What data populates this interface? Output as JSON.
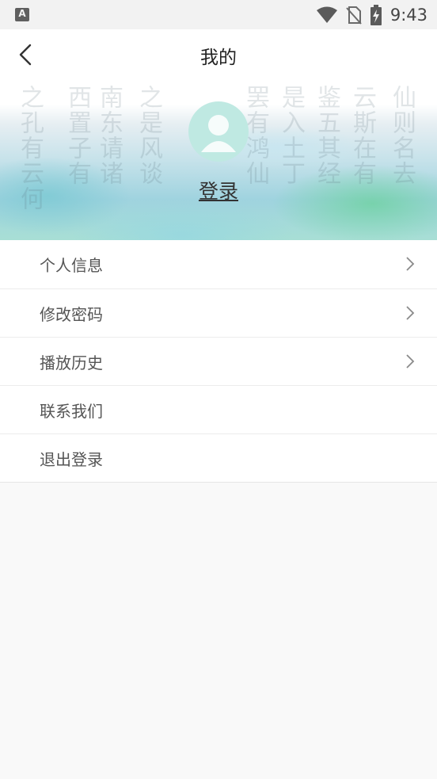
{
  "status_bar": {
    "app_icon_letter": "A",
    "time": "9:43",
    "icons": [
      "wifi-icon",
      "no-sim-icon",
      "battery-charging-icon"
    ]
  },
  "header": {
    "title": "我的",
    "back_icon": "chevron-left-icon"
  },
  "profile": {
    "avatar_icon": "avatar-placeholder-icon",
    "login_label": "登录"
  },
  "menu": {
    "items": [
      {
        "label": "个人信息",
        "has_chevron": true
      },
      {
        "label": "修改密码",
        "has_chevron": true
      },
      {
        "label": "播放历史",
        "has_chevron": true
      },
      {
        "label": "联系我们",
        "has_chevron": false
      },
      {
        "label": "退出登录",
        "has_chevron": false
      }
    ]
  },
  "colors": {
    "page_background": "#f9f9f9",
    "avatar": "#bfe9e2",
    "text_primary": "#222222",
    "text_menu": "#555555"
  }
}
